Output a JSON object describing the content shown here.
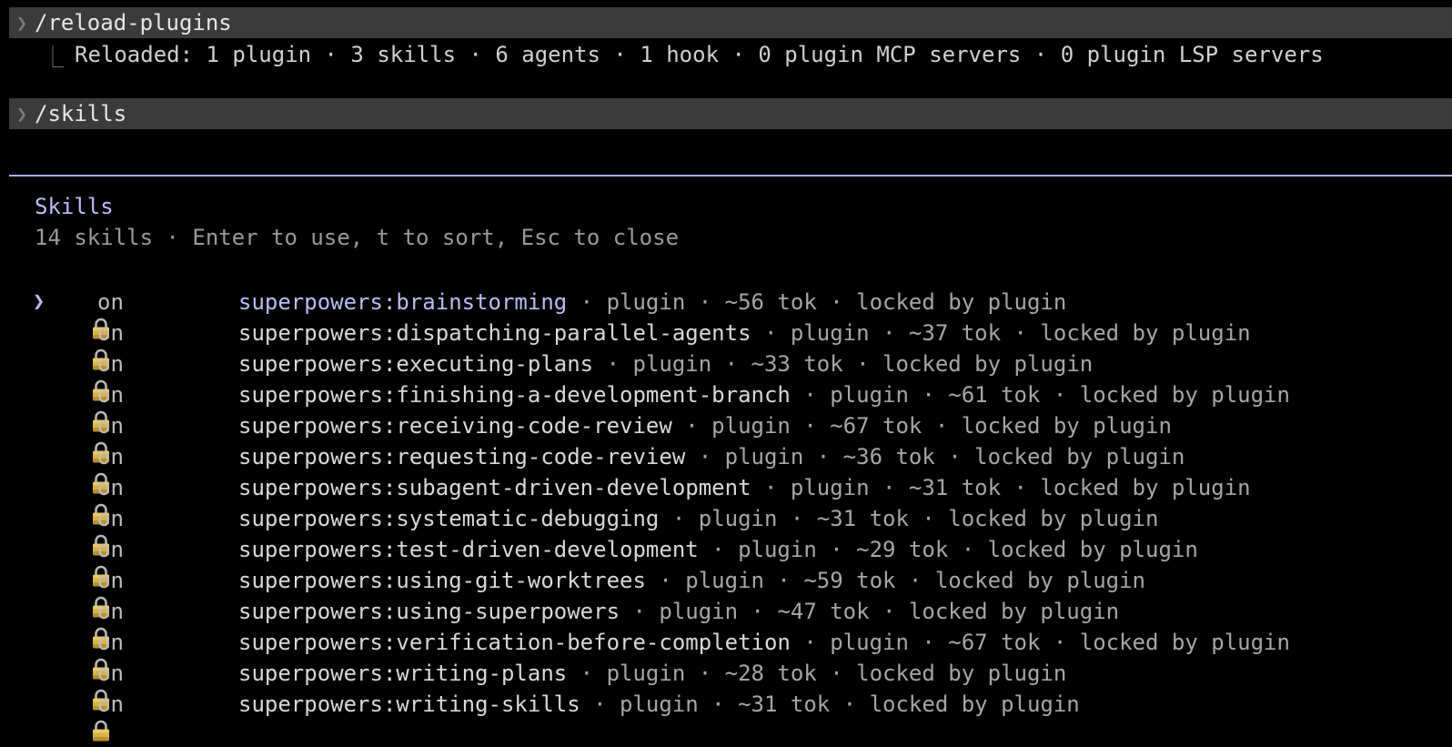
{
  "commands": [
    {
      "text": "/reload-plugins"
    },
    {
      "text": "/skills"
    }
  ],
  "reload_result": "Reloaded: 1 plugin · 3 skills · 6 agents · 1 hook · 0 plugin MCP servers · 0 plugin LSP servers",
  "panel": {
    "title": "Skills",
    "subtitle": "14 skills · Enter to use, t to sort, Esc to close"
  },
  "selected_index": 0,
  "skills": [
    {
      "status": "on",
      "name": "superpowers:brainstorming",
      "meta": " · plugin · ~56 tok · locked by plugin"
    },
    {
      "status": "on",
      "name": "superpowers:dispatching-parallel-agents",
      "meta": " · plugin · ~37 tok · locked by plugin"
    },
    {
      "status": "on",
      "name": "superpowers:executing-plans",
      "meta": " · plugin · ~33 tok · locked by plugin"
    },
    {
      "status": "on",
      "name": "superpowers:finishing-a-development-branch",
      "meta": " · plugin · ~61 tok · locked by plugin"
    },
    {
      "status": "on",
      "name": "superpowers:receiving-code-review",
      "meta": " · plugin · ~67 tok · locked by plugin"
    },
    {
      "status": "on",
      "name": "superpowers:requesting-code-review",
      "meta": " · plugin · ~36 tok · locked by plugin"
    },
    {
      "status": "on",
      "name": "superpowers:subagent-driven-development",
      "meta": " · plugin · ~31 tok · locked by plugin"
    },
    {
      "status": "on",
      "name": "superpowers:systematic-debugging",
      "meta": " · plugin · ~31 tok · locked by plugin"
    },
    {
      "status": "on",
      "name": "superpowers:test-driven-development",
      "meta": " · plugin · ~29 tok · locked by plugin"
    },
    {
      "status": "on",
      "name": "superpowers:using-git-worktrees",
      "meta": " · plugin · ~59 tok · locked by plugin"
    },
    {
      "status": "on",
      "name": "superpowers:using-superpowers",
      "meta": " · plugin · ~47 tok · locked by plugin"
    },
    {
      "status": "on",
      "name": "superpowers:verification-before-completion",
      "meta": " · plugin · ~67 tok · locked by plugin"
    },
    {
      "status": "on",
      "name": "superpowers:writing-plans",
      "meta": " · plugin · ~28 tok · locked by plugin"
    },
    {
      "status": "on",
      "name": "superpowers:writing-skills",
      "meta": " · plugin · ~31 tok · locked by plugin"
    }
  ],
  "icons": {
    "prompt": "chevron-right-icon",
    "tree": "tree-corner-icon",
    "selection": "selection-pointer-icon",
    "skill": "lock-icon"
  },
  "colors": {
    "accent": "#b9bdf5",
    "command_bar": "#3b3b3b",
    "lock_body": "#d8b24a"
  }
}
